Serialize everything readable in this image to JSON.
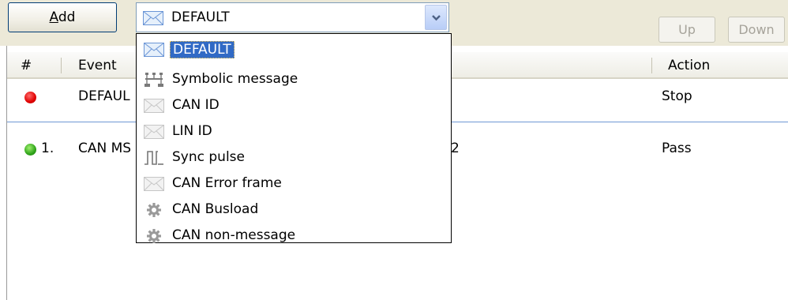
{
  "toolbar": {
    "add_label_accel": "A",
    "add_label_rest": "dd",
    "combo_value": "DEFAULT",
    "up_label": "Up",
    "down_label": "Down"
  },
  "table": {
    "columns": [
      "#",
      "Event",
      "Action"
    ],
    "rows": [
      {
        "num": "",
        "event": "DEFAUL",
        "action": "Stop",
        "status": "red"
      },
      {
        "num": "1.",
        "event": "CAN MS",
        "event_tail": "2",
        "action": "Pass",
        "status": "green"
      }
    ]
  },
  "dropdown": {
    "items": [
      {
        "label": "DEFAULT",
        "icon": "envelope-icon",
        "selected": true
      },
      {
        "label": "Symbolic message",
        "icon": "symbolic-message-icon"
      },
      {
        "label": "CAN ID",
        "icon": "envelope-icon"
      },
      {
        "label": "LIN ID",
        "icon": "envelope-icon"
      },
      {
        "label": "Sync pulse",
        "icon": "pulse-icon"
      },
      {
        "label": "CAN Error frame",
        "icon": "envelope-icon"
      },
      {
        "label": "CAN Busload",
        "icon": "gear-icon"
      },
      {
        "label": "CAN non-message",
        "icon": "gear-icon"
      }
    ]
  },
  "colors": {
    "selection": "#316ac5",
    "toolbar_bg": "#ece9d8",
    "status_red": "#e00000",
    "status_green": "#2fa31a"
  }
}
